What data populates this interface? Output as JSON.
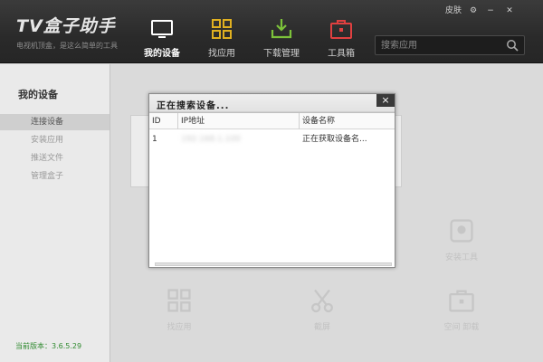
{
  "app": {
    "title": "TV盒子助手",
    "subtitle": "电视机顶盒，是这么简单的工具"
  },
  "nav": [
    {
      "label": "我的设备",
      "icon": "tv-icon",
      "active": true
    },
    {
      "label": "找应用",
      "icon": "grid-apps-icon",
      "active": false
    },
    {
      "label": "下载管理",
      "icon": "download-tray-icon",
      "active": false
    },
    {
      "label": "工具箱",
      "icon": "toolbox-icon",
      "active": false
    }
  ],
  "window_controls": {
    "skin": "皮肤",
    "settings": "⚙",
    "minimize": "−",
    "close": "✕"
  },
  "search": {
    "placeholder": "搜索应用"
  },
  "sidebar": {
    "title": "我的设备",
    "items": [
      {
        "label": "连接设备",
        "selected": true
      },
      {
        "label": "安装应用",
        "selected": false
      },
      {
        "label": "推送文件",
        "selected": false
      },
      {
        "label": "管理盒子",
        "selected": false
      }
    ],
    "version": "当前版本：3.6.5.29"
  },
  "main": {
    "tiles": [
      {
        "label": "找应用",
        "icon": "grid-apps-icon"
      },
      {
        "label": "截屏",
        "icon": "scissors-icon"
      },
      {
        "label": "安装工具",
        "icon": "disk-icon"
      },
      {
        "label": "空间 卸载",
        "icon": "toolbox-icon"
      }
    ]
  },
  "dialog": {
    "title": "正在搜索设备...",
    "close": "×",
    "columns": [
      "ID",
      "IP地址",
      "设备名称"
    ],
    "rows": [
      {
        "id": "1",
        "ip": "192.168.1.100",
        "name": "正在获取设备名..."
      }
    ]
  },
  "colors": {
    "topbar": "#2a2a2a",
    "active_tab": "#ffffff",
    "version_text": "#2f8a2f",
    "icon_yellow": "#e0b020",
    "icon_green": "#7cc23a",
    "icon_red": "#e04040"
  }
}
